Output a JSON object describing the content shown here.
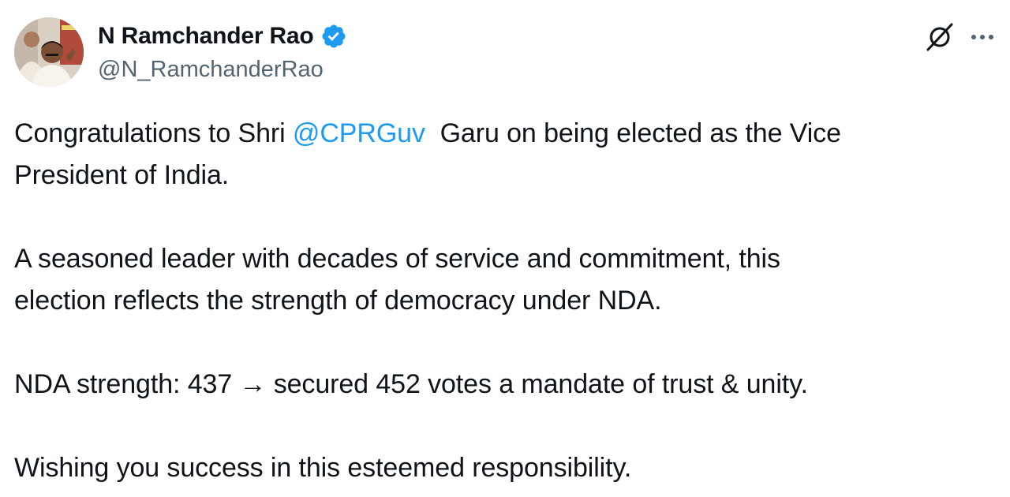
{
  "author": {
    "display_name": "N Ramchander Rao",
    "handle": "@N_RamchanderRao",
    "verified": true,
    "avatar_icon": "profile-photo"
  },
  "actions": {
    "grok_icon": "grok-slash-icon",
    "more_icon": "more-dots-icon"
  },
  "tweet": {
    "p1_before": "Congratulations to Shri ",
    "p1_mention": "@CPRGuv",
    "p1_after_line1": "  Garu on being elected as the Vice",
    "p1_line2": "President of India.",
    "p2_line1": "A seasoned leader with decades of service and commitment, this",
    "p2_line2": "election reflects the strength of democracy under NDA.",
    "p3": "NDA strength: 437 → secured 452 votes a mandate of trust & unity.",
    "p4": "Wishing you success in this esteemed responsibility."
  },
  "colors": {
    "link": "#1d9bf0",
    "verified": "#1d9bf0",
    "secondary_text": "#536471",
    "primary_text": "#0f1419"
  }
}
